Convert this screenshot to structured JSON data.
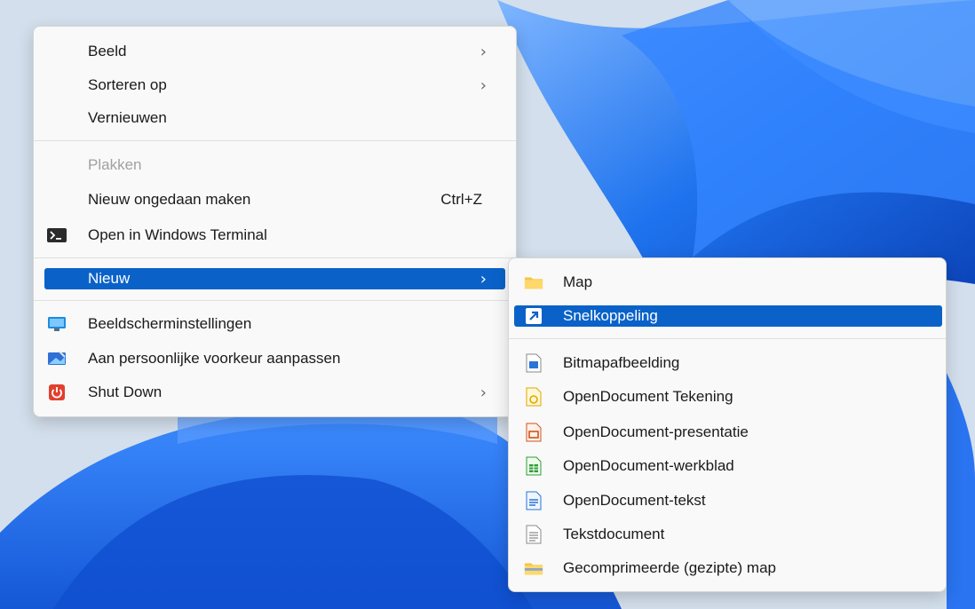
{
  "colors": {
    "menu_bg": "#f9f9f9",
    "highlight": "#0a62c9",
    "disabled_text": "#a1a1a1",
    "wallpaper_blue": "#1a6cf0"
  },
  "context_menu": {
    "items": [
      {
        "label": "Beeld",
        "submenu": true
      },
      {
        "label": "Sorteren op",
        "submenu": true
      },
      {
        "label": "Vernieuwen"
      },
      {
        "label": "Plakken",
        "disabled": true
      },
      {
        "label": "Nieuw ongedaan maken",
        "shortcut": "Ctrl+Z"
      },
      {
        "label": "Open in Windows Terminal",
        "icon": "terminal-icon"
      },
      {
        "label": "Nieuw",
        "submenu": true,
        "highlighted": true
      },
      {
        "label": "Beeldscherminstellingen",
        "icon": "display-settings-icon"
      },
      {
        "label": "Aan persoonlijke voorkeur aanpassen",
        "icon": "personalize-icon"
      },
      {
        "label": "Shut Down",
        "icon": "power-icon",
        "submenu": true
      }
    ]
  },
  "new_submenu": {
    "items": [
      {
        "label": "Map",
        "icon": "folder-icon"
      },
      {
        "label": "Snelkoppeling",
        "icon": "shortcut-icon",
        "highlighted": true
      },
      {
        "label": "Bitmapafbeelding",
        "icon": "bitmap-icon"
      },
      {
        "label": "OpenDocument Tekening",
        "icon": "odg-icon"
      },
      {
        "label": "OpenDocument-presentatie",
        "icon": "odp-icon"
      },
      {
        "label": "OpenDocument-werkblad",
        "icon": "ods-icon"
      },
      {
        "label": "OpenDocument-tekst",
        "icon": "odt-icon"
      },
      {
        "label": "Tekstdocument",
        "icon": "text-document-icon"
      },
      {
        "label": "Gecomprimeerde (gezipte) map",
        "icon": "zip-folder-icon"
      }
    ]
  },
  "chevron_glyph": "›"
}
